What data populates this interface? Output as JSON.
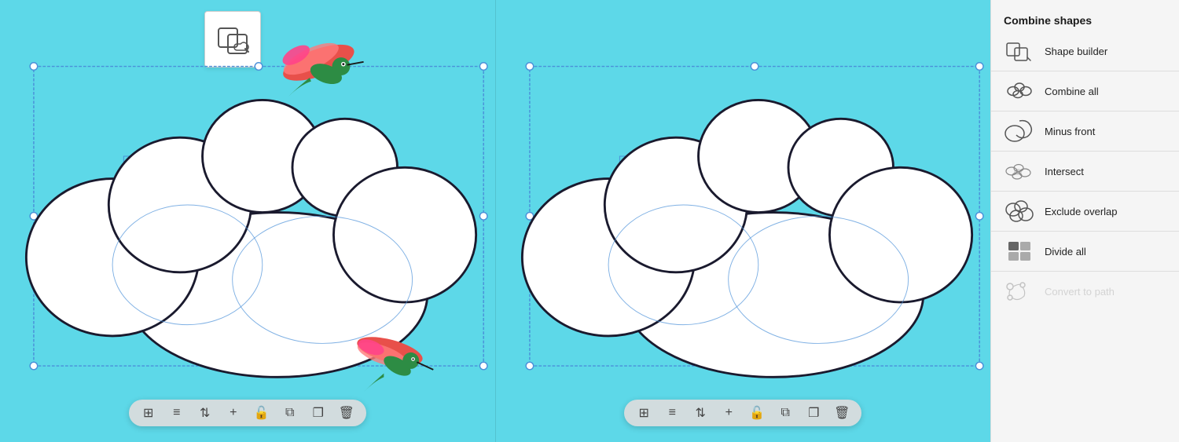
{
  "sidebar": {
    "title": "Combine shapes",
    "items": [
      {
        "id": "shape-builder",
        "label": "Shape builder",
        "disabled": false
      },
      {
        "id": "combine-all",
        "label": "Combine all",
        "disabled": false
      },
      {
        "id": "minus-front",
        "label": "Minus front",
        "disabled": false
      },
      {
        "id": "intersect",
        "label": "Intersect",
        "disabled": false
      },
      {
        "id": "exclude-overlap",
        "label": "Exclude overlap",
        "disabled": false
      },
      {
        "id": "divide-all",
        "label": "Divide all",
        "disabled": false
      },
      {
        "id": "convert-to-path",
        "label": "Convert to path",
        "disabled": true
      }
    ]
  },
  "toolbar": {
    "icons": [
      "⊞",
      "≡",
      "⇅",
      "+",
      "🔓",
      "⧉",
      "❐",
      "🗑"
    ]
  }
}
